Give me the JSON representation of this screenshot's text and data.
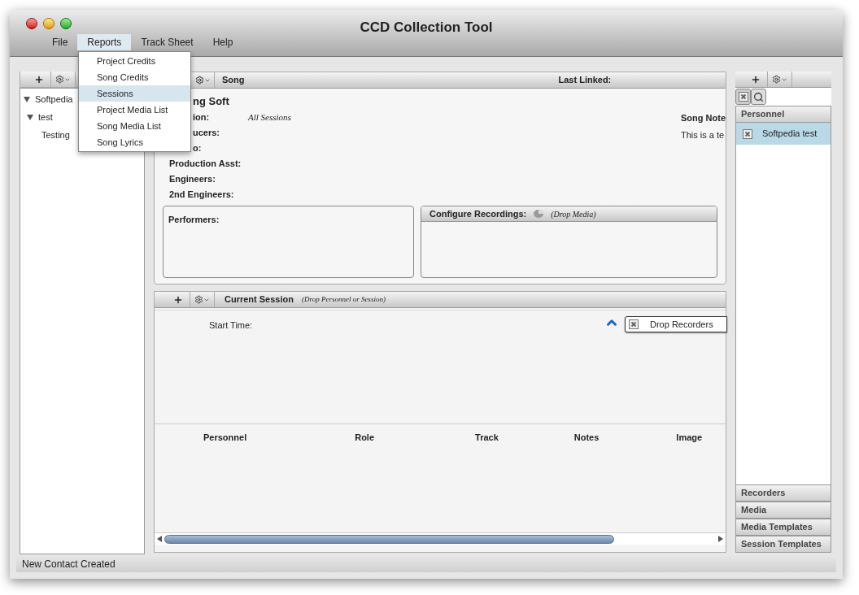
{
  "window": {
    "title": "CCD Collection Tool"
  },
  "menu_bar": [
    {
      "label": "File",
      "selected": false
    },
    {
      "label": "Reports",
      "selected": true
    },
    {
      "label": "Track Sheet",
      "selected": false
    },
    {
      "label": "Help",
      "selected": false
    }
  ],
  "open_menu": {
    "items": [
      {
        "label": "Project Credits",
        "selected": false
      },
      {
        "label": "Song Credits",
        "selected": false
      },
      {
        "label": "Sessions",
        "selected": true
      },
      {
        "label": "Project Media List",
        "selected": false
      },
      {
        "label": "Song Media List",
        "selected": false
      },
      {
        "label": "Song Lyrics",
        "selected": false
      }
    ]
  },
  "left_panel": {
    "tree": [
      {
        "label": "Softpedia",
        "expanded": true,
        "children": [
          {
            "label": "test",
            "expanded": true,
            "children": [
              {
                "label": "Testing"
              }
            ]
          }
        ]
      }
    ]
  },
  "song_panel": {
    "title": "Song",
    "last_linked": "Last Linked:",
    "song_title": "ng Soft",
    "notes_label": "Song Note",
    "notes_text": "This is a te",
    "fields": [
      {
        "label": "ion:",
        "value": "All Sessions",
        "cut": true
      },
      {
        "label": "ucers:",
        "cut": true
      },
      {
        "label": "o:",
        "cut": true
      },
      {
        "label": "Production Asst:",
        "cut": false
      },
      {
        "label": "Engineers:",
        "cut": false
      },
      {
        "label": "2nd Engineers:",
        "cut": false
      }
    ],
    "performers": "Performers:",
    "recordings": {
      "label": "Configure Recordings:",
      "hint": "(Drop Media)"
    }
  },
  "session_panel": {
    "title": "Current Session",
    "hint": "(Drop Personnel or Session)",
    "start_time": "Start Time:",
    "drop_recorders": "Drop Recorders",
    "columns": [
      "Personnel",
      "Role",
      "Track",
      "Notes",
      "Image"
    ]
  },
  "right_panel": {
    "personnel": "Personnel",
    "items": [
      {
        "name": "Softpedia test",
        "selected": true
      }
    ],
    "sections": [
      "Recorders",
      "Media",
      "Media Templates",
      "Session Templates"
    ]
  },
  "status_bar": "New Contact Created"
}
